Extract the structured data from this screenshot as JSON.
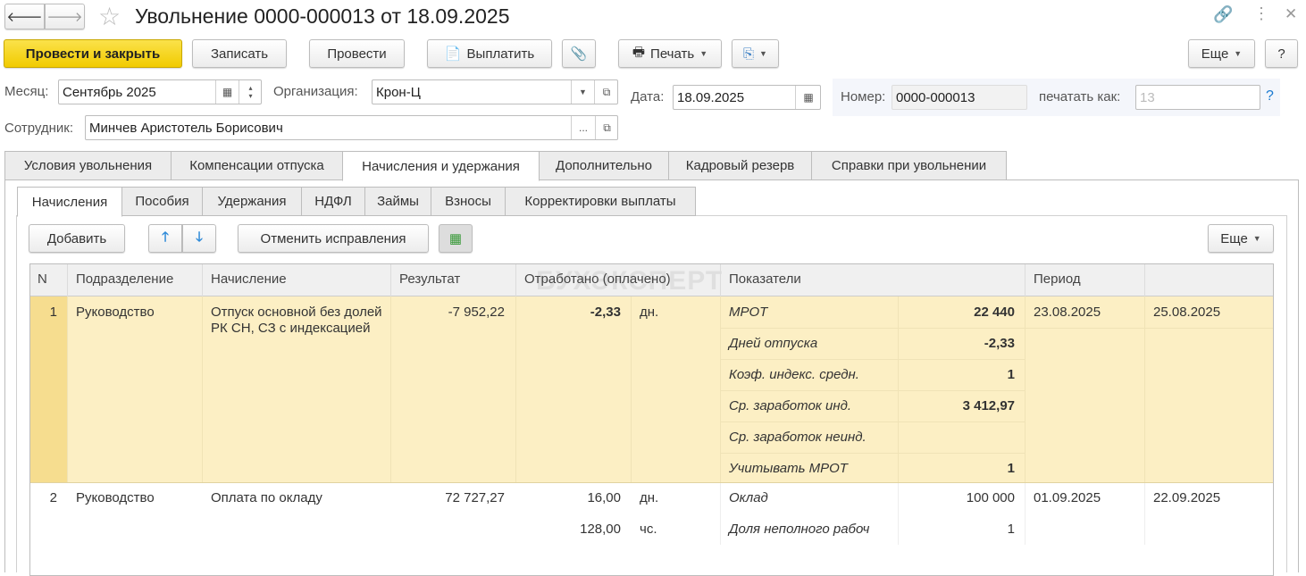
{
  "title": "Увольнение 0000-000013 от 18.09.2025",
  "toolbar": {
    "post_close": "Провести и закрыть",
    "save": "Записать",
    "post": "Провести",
    "pay": "Выплатить",
    "print": "Печать",
    "more": "Еще",
    "help": "?"
  },
  "fields": {
    "month_label": "Месяц:",
    "month": "Сентябрь 2025",
    "org_label": "Организация:",
    "org": "Крон-Ц",
    "date_label": "Дата:",
    "date": "18.09.2025",
    "number_label": "Номер:",
    "number": "0000-000013",
    "print_as_label": "печатать как:",
    "print_as_placeholder": "13",
    "print_as_help": "?",
    "employee_label": "Сотрудник:",
    "employee": "Минчев Аристотель Борисович",
    "select_btn": "..."
  },
  "tabs": [
    "Условия увольнения",
    "Компенсации отпуска",
    "Начисления и удержания",
    "Дополнительно",
    "Кадровый резерв",
    "Справки при увольнении"
  ],
  "subtabs": [
    "Начисления",
    "Пособия",
    "Удержания",
    "НДФЛ",
    "Займы",
    "Взносы",
    "Корректировки выплаты"
  ],
  "grid_toolbar": {
    "add": "Добавить",
    "cancel_fix": "Отменить исправления",
    "more": "Еще"
  },
  "watermark": "БУХЭКСПЕРТ",
  "table": {
    "headers": [
      "N",
      "Подразделение",
      "Начисление",
      "Результат",
      "Отработано (оплачено)",
      "Показатели",
      "Период"
    ],
    "rows": [
      {
        "n": "1",
        "dept": "Руководство",
        "accrual": "Отпуск основной без долей РК СН, СЗ с индексацией",
        "result": "-7 952,22",
        "worked": [
          {
            "value": "-2,33",
            "unit": "дн."
          }
        ],
        "indicators": [
          {
            "name": "МРОТ",
            "value": "22 440"
          },
          {
            "name": "Дней отпуска",
            "value": "-2,33"
          },
          {
            "name": "Коэф. индекс. средн.",
            "value": "1"
          },
          {
            "name": "Ср. заработок инд.",
            "value": "3 412,97"
          },
          {
            "name": "Ср. заработок неинд.",
            "value": ""
          },
          {
            "name": "Учитывать МРОТ",
            "value": "1"
          }
        ],
        "from": "23.08.2025",
        "to": "25.08.2025"
      },
      {
        "n": "2",
        "dept": "Руководство",
        "accrual": "Оплата по окладу",
        "result": "72 727,27",
        "worked": [
          {
            "value": "16,00",
            "unit": "дн."
          },
          {
            "value": "128,00",
            "unit": "чс."
          }
        ],
        "indicators": [
          {
            "name": "Оклад",
            "value": "100 000"
          },
          {
            "name": "Доля неполного рабоч",
            "value": "1"
          }
        ],
        "from": "01.09.2025",
        "to": "22.09.2025"
      }
    ]
  }
}
